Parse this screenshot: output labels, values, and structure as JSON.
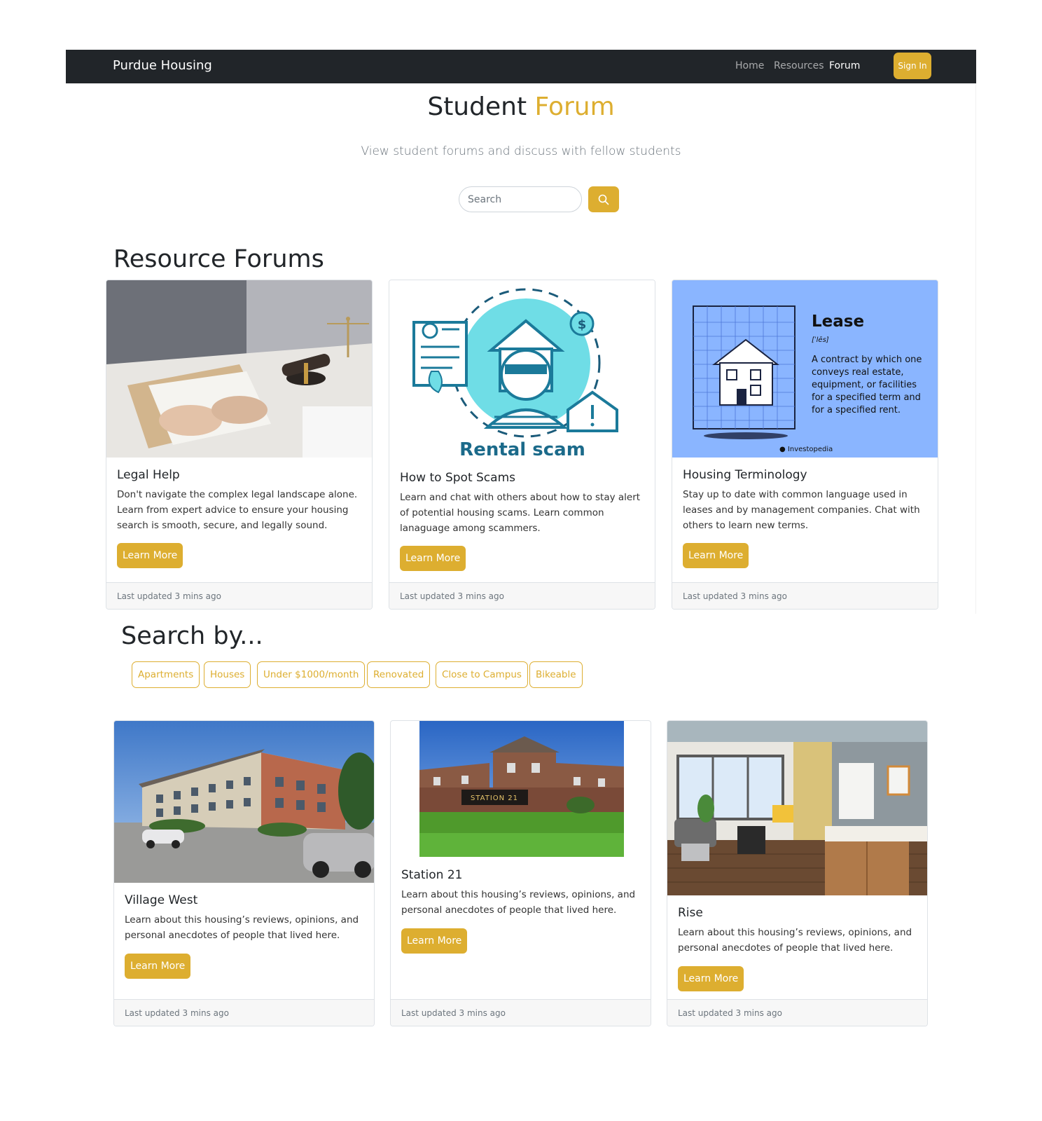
{
  "navbar": {
    "brand": "Purdue Housing",
    "links": [
      "Home",
      "Resources",
      "Forum"
    ],
    "active": "Forum",
    "sign_in": "Sign In"
  },
  "hero": {
    "title_main": "Student",
    "title_accent": "Forum",
    "subtitle": "View student forums and discuss with fellow students",
    "search_placeholder": "Search"
  },
  "resource_forums": {
    "heading": "Resource Forums",
    "cards": [
      {
        "title": "Legal Help",
        "text": "Don't navigate the complex legal landscape alone. Learn from expert advice to ensure your housing search is smooth, secure, and legally sound.",
        "button": "Learn More",
        "footer": "Last updated 3 mins ago"
      },
      {
        "title": "How to Spot Scams",
        "text": "Learn and chat with others about how to stay alert of potential housing scams. Learn common lanaguage among scammers.",
        "button": "Learn More",
        "footer": "Last updated 3 mins ago",
        "image_caption": "Rental scam"
      },
      {
        "title": "Housing Terminology",
        "text": "Stay up to date with common language used in leases and by management companies. Chat with others to learn new terms.",
        "button": "Learn More",
        "footer": "Last updated 3 mins ago",
        "image_heading": "Lease",
        "image_pron": "[ˈlēs]",
        "image_definition": "A contract by which one conveys real estate, equipment, or facilities for a specified term and for a specified rent.",
        "image_credit": "Investopedia"
      }
    ]
  },
  "search_by": {
    "heading": "Search by...",
    "tags": [
      "Apartments",
      "Houses",
      "Under $1000/month",
      "Renovated",
      "Close to Campus",
      "Bikeable"
    ]
  },
  "housing": {
    "cards": [
      {
        "title": "Village West",
        "text": "Learn about this housing’s reviews, opinions, and personal anecdotes of people that lived here.",
        "button": "Learn More",
        "footer": "Last updated 3 mins ago"
      },
      {
        "title": "Station 21",
        "text": "Learn about this housing’s reviews, opinions, and personal anecdotes of people that lived here.",
        "button": "Learn More",
        "footer": "Last updated 3 mins ago",
        "sign_text": "STATION 21"
      },
      {
        "title": "Rise",
        "text": "Learn about this housing’s reviews, opinions, and personal anecdotes of people that lived here.",
        "button": "Learn More",
        "footer": "Last updated 3 mins ago"
      }
    ]
  },
  "colors": {
    "accent": "#ddae30",
    "navbar": "#212529",
    "footer_bg": "#f7f7f7"
  }
}
